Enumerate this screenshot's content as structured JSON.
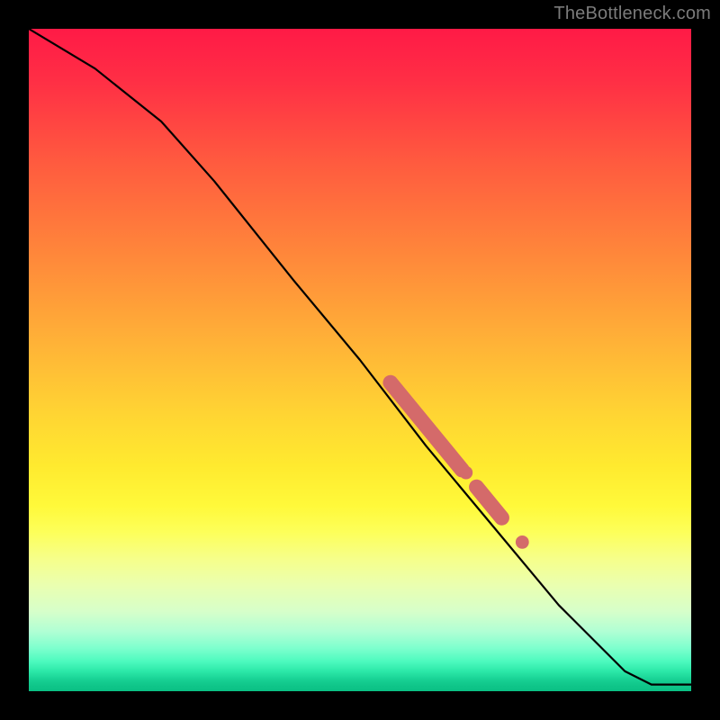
{
  "attribution": "TheBottleneck.com",
  "colors": {
    "page_bg": "#000000",
    "gradient_top": "#ff1a46",
    "gradient_mid": "#ffe633",
    "gradient_bottom": "#0ac084",
    "line": "#000000",
    "marker": "#d46a6a"
  },
  "chart_data": {
    "type": "line",
    "title": "",
    "xlabel": "",
    "ylabel": "",
    "xlim": [
      0,
      100
    ],
    "ylim": [
      0,
      100
    ],
    "grid": false,
    "legend": false,
    "series": [
      {
        "name": "curve",
        "x": [
          0,
          10,
          20,
          28,
          40,
          50,
          60,
          70,
          80,
          90,
          94,
          100
        ],
        "y": [
          100,
          94,
          86,
          77,
          62,
          50,
          37,
          25,
          13,
          3,
          1,
          1
        ]
      }
    ],
    "markers": [
      {
        "shape": "pill",
        "x_center": 60.0,
        "y_center": 40.0,
        "length": 17,
        "thickness": 2.3
      },
      {
        "shape": "pill",
        "x_center": 69.5,
        "y_center": 28.5,
        "length": 6,
        "thickness": 2.3
      },
      {
        "shape": "circle",
        "x_center": 66.0,
        "y_center": 33.0,
        "r": 1.0
      },
      {
        "shape": "circle",
        "x_center": 74.5,
        "y_center": 22.5,
        "r": 1.0
      }
    ]
  }
}
